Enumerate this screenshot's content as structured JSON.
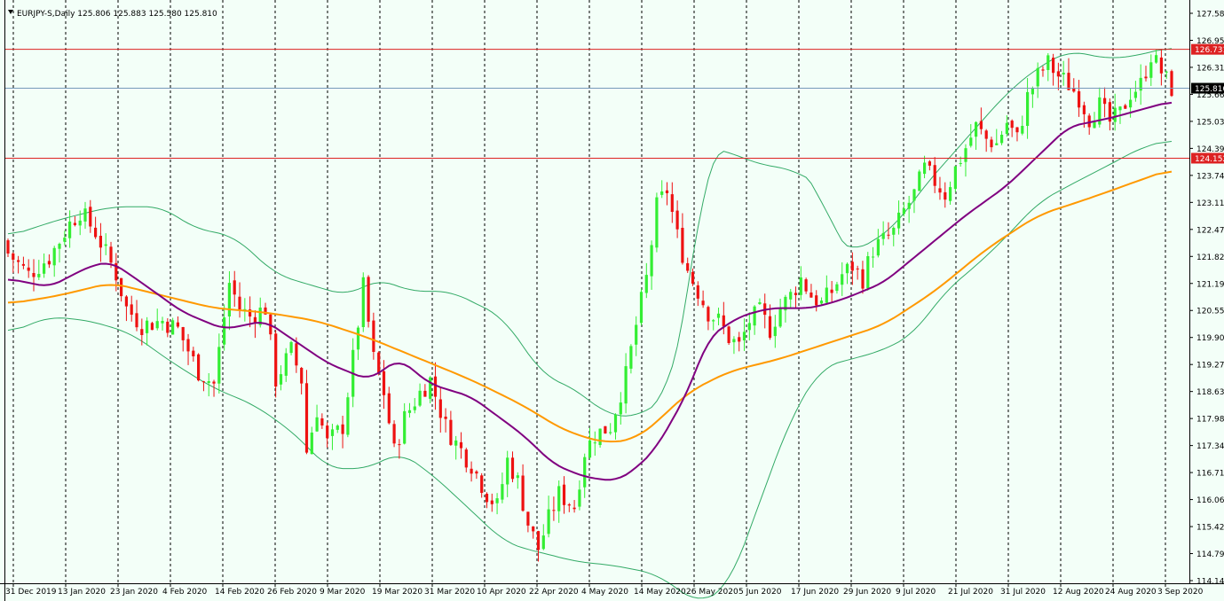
{
  "window": {
    "symbol_info": "EURJPY-S,Daily  125.806 125.883 125.580 125.810",
    "menu_icon": "triangle-down-icon"
  },
  "colors": {
    "background": "#f3fff8",
    "bull_candle": "#33ee33",
    "bear_candle": "#ee1111",
    "bollinger": "#33aa66",
    "ma_fast": "#800080",
    "ma_slow": "#ff9900",
    "hline": "#dd2222",
    "price_line": "#7799bb",
    "grid": "#000000"
  },
  "price_axis": {
    "ticks": [
      "127.585",
      "126.955",
      "126.310",
      "125.665",
      "125.035",
      "124.390",
      "123.745",
      "123.115",
      "122.470",
      "121.825",
      "121.195",
      "120.550",
      "119.905",
      "119.275",
      "118.630",
      "117.985",
      "117.340",
      "116.710",
      "116.065",
      "115.420",
      "114.790",
      "114.145"
    ],
    "hline_labels": [
      "126.731",
      "124.152"
    ],
    "current_price_label": "125.810"
  },
  "time_axis": {
    "labels": [
      "31 Dec 2019",
      "13 Jan 2020",
      "23 Jan 2020",
      "4 Feb 2020",
      "14 Feb 2020",
      "26 Feb 2020",
      "9 Mar 2020",
      "19 Mar 2020",
      "31 Mar 2020",
      "10 Apr 2020",
      "22 Apr 2020",
      "4 May 2020",
      "14 May 2020",
      "26 May 2020",
      "5 Jun 2020",
      "17 Jun 2020",
      "29 Jun 2020",
      "9 Jul 2020",
      "21 Jul 2020",
      "31 Jul 2020",
      "12 Aug 2020",
      "24 Aug 2020",
      "3 Sep 2020"
    ]
  },
  "chart_data": {
    "type": "candlestick",
    "title": "EURJPY-S,Daily",
    "ohlc_latest": {
      "open": 125.806,
      "high": 125.883,
      "low": 125.58,
      "close": 125.81
    },
    "ylim": [
      114.145,
      127.585
    ],
    "horizontal_lines": [
      126.731,
      124.152
    ],
    "current_price": 125.81,
    "close_path_anchors": [
      [
        0,
        121.9
      ],
      [
        4,
        121.4
      ],
      [
        8,
        121.8
      ],
      [
        12,
        122.6
      ],
      [
        14,
        122.9
      ],
      [
        17,
        122.4
      ],
      [
        21,
        121.4
      ],
      [
        23,
        120.6
      ],
      [
        26,
        120.2
      ],
      [
        30,
        120.3
      ],
      [
        33,
        120.1
      ],
      [
        35,
        119.6
      ],
      [
        37,
        119.1
      ],
      [
        40,
        118.8
      ],
      [
        43,
        121.2
      ],
      [
        45,
        120.6
      ],
      [
        47,
        120.4
      ],
      [
        50,
        120.6
      ],
      [
        52,
        118.9
      ],
      [
        55,
        119.6
      ],
      [
        57,
        118.9
      ],
      [
        58,
        117.2
      ],
      [
        60,
        118.2
      ],
      [
        62,
        117.4
      ],
      [
        65,
        117.8
      ],
      [
        67,
        119.4
      ],
      [
        69,
        121.1
      ],
      [
        71,
        119.4
      ],
      [
        73,
        118.6
      ],
      [
        75,
        117.2
      ],
      [
        77,
        118.0
      ],
      [
        80,
        118.6
      ],
      [
        82,
        118.9
      ],
      [
        85,
        117.8
      ],
      [
        87,
        117.4
      ],
      [
        90,
        116.9
      ],
      [
        93,
        116.2
      ],
      [
        95,
        115.9
      ],
      [
        97,
        117.0
      ],
      [
        99,
        116.5
      ],
      [
        101,
        115.5
      ],
      [
        103,
        114.9
      ],
      [
        105,
        115.6
      ],
      [
        107,
        116.2
      ],
      [
        110,
        115.9
      ],
      [
        112,
        117.2
      ],
      [
        114,
        117.6
      ],
      [
        117,
        117.8
      ],
      [
        120,
        119.0
      ],
      [
        122,
        120.2
      ],
      [
        124,
        121.3
      ],
      [
        126,
        123.0
      ],
      [
        128,
        123.4
      ],
      [
        130,
        122.3
      ],
      [
        132,
        121.5
      ],
      [
        134,
        121.0
      ],
      [
        136,
        120.5
      ],
      [
        138,
        120.3
      ],
      [
        140,
        119.9
      ],
      [
        142,
        119.7
      ],
      [
        144,
        120.3
      ],
      [
        146,
        120.5
      ],
      [
        148,
        120.1
      ],
      [
        150,
        120.6
      ],
      [
        152,
        120.9
      ],
      [
        154,
        121.3
      ],
      [
        156,
        120.9
      ],
      [
        158,
        120.7
      ],
      [
        160,
        121.0
      ],
      [
        162,
        121.4
      ],
      [
        164,
        121.6
      ],
      [
        166,
        121.3
      ],
      [
        168,
        122.0
      ],
      [
        170,
        122.2
      ],
      [
        172,
        122.4
      ],
      [
        174,
        122.9
      ],
      [
        176,
        123.3
      ],
      [
        178,
        123.9
      ],
      [
        180,
        123.6
      ],
      [
        182,
        123.3
      ],
      [
        184,
        123.9
      ],
      [
        186,
        124.4
      ],
      [
        188,
        124.9
      ],
      [
        190,
        124.6
      ],
      [
        192,
        124.5
      ],
      [
        194,
        125.0
      ],
      [
        196,
        124.6
      ],
      [
        198,
        125.6
      ],
      [
        200,
        126.1
      ],
      [
        202,
        126.4
      ],
      [
        204,
        126.1
      ],
      [
        206,
        125.9
      ],
      [
        208,
        125.6
      ],
      [
        210,
        125.1
      ],
      [
        212,
        125.4
      ],
      [
        214,
        125.0
      ],
      [
        216,
        125.2
      ],
      [
        218,
        125.7
      ],
      [
        220,
        125.9
      ],
      [
        222,
        126.6
      ],
      [
        224,
        126.2
      ],
      [
        226,
        125.8
      ]
    ],
    "ma_slow_anchors": [
      [
        0,
        120.7
      ],
      [
        10,
        120.9
      ],
      [
        20,
        121.2
      ],
      [
        30,
        120.9
      ],
      [
        40,
        120.6
      ],
      [
        50,
        120.5
      ],
      [
        60,
        120.3
      ],
      [
        70,
        119.9
      ],
      [
        80,
        119.4
      ],
      [
        90,
        118.9
      ],
      [
        100,
        118.3
      ],
      [
        108,
        117.7
      ],
      [
        116,
        117.4
      ],
      [
        122,
        117.5
      ],
      [
        126,
        117.9
      ],
      [
        132,
        118.6
      ],
      [
        140,
        119.1
      ],
      [
        150,
        119.4
      ],
      [
        160,
        119.8
      ],
      [
        170,
        120.2
      ],
      [
        180,
        121.0
      ],
      [
        190,
        122.0
      ],
      [
        200,
        122.8
      ],
      [
        210,
        123.2
      ],
      [
        226,
        123.9
      ]
    ],
    "ma_fast_anchors": [
      [
        0,
        121.3
      ],
      [
        8,
        121.1
      ],
      [
        16,
        121.6
      ],
      [
        20,
        121.7
      ],
      [
        26,
        121.2
      ],
      [
        34,
        120.5
      ],
      [
        42,
        120.1
      ],
      [
        50,
        120.3
      ],
      [
        56,
        119.8
      ],
      [
        62,
        119.3
      ],
      [
        70,
        118.9
      ],
      [
        76,
        119.4
      ],
      [
        82,
        118.8
      ],
      [
        90,
        118.5
      ],
      [
        100,
        117.6
      ],
      [
        106,
        116.9
      ],
      [
        112,
        116.6
      ],
      [
        118,
        116.5
      ],
      [
        122,
        116.8
      ],
      [
        126,
        117.3
      ],
      [
        132,
        118.6
      ],
      [
        136,
        119.9
      ],
      [
        142,
        120.4
      ],
      [
        148,
        120.6
      ],
      [
        156,
        120.6
      ],
      [
        162,
        120.8
      ],
      [
        170,
        121.2
      ],
      [
        178,
        122.0
      ],
      [
        186,
        122.8
      ],
      [
        194,
        123.5
      ],
      [
        200,
        124.2
      ],
      [
        206,
        124.9
      ],
      [
        214,
        125.1
      ],
      [
        220,
        125.3
      ],
      [
        226,
        125.5
      ]
    ],
    "bb_upper_anchors": [
      [
        0,
        122.3
      ],
      [
        10,
        122.7
      ],
      [
        20,
        123.0
      ],
      [
        30,
        123.0
      ],
      [
        36,
        122.5
      ],
      [
        44,
        122.3
      ],
      [
        52,
        121.4
      ],
      [
        60,
        121.1
      ],
      [
        66,
        120.9
      ],
      [
        72,
        121.3
      ],
      [
        78,
        121.0
      ],
      [
        86,
        121.0
      ],
      [
        96,
        120.4
      ],
      [
        104,
        119.0
      ],
      [
        110,
        118.7
      ],
      [
        116,
        118.1
      ],
      [
        122,
        118.0
      ],
      [
        128,
        118.5
      ],
      [
        132,
        120.6
      ],
      [
        134,
        122.8
      ],
      [
        136,
        124.4
      ],
      [
        140,
        124.3
      ],
      [
        146,
        124.0
      ],
      [
        152,
        123.9
      ],
      [
        158,
        123.5
      ],
      [
        160,
        122.3
      ],
      [
        164,
        121.9
      ],
      [
        172,
        122.5
      ],
      [
        178,
        123.5
      ],
      [
        186,
        124.6
      ],
      [
        194,
        125.7
      ],
      [
        200,
        126.3
      ],
      [
        206,
        126.7
      ],
      [
        214,
        126.5
      ],
      [
        220,
        126.6
      ],
      [
        226,
        126.8
      ]
    ],
    "bb_lower_anchors": [
      [
        0,
        120.0
      ],
      [
        8,
        120.4
      ],
      [
        16,
        120.3
      ],
      [
        24,
        120.0
      ],
      [
        32,
        119.3
      ],
      [
        40,
        118.7
      ],
      [
        48,
        118.3
      ],
      [
        56,
        117.6
      ],
      [
        62,
        116.8
      ],
      [
        70,
        116.8
      ],
      [
        76,
        117.2
      ],
      [
        82,
        116.7
      ],
      [
        90,
        115.8
      ],
      [
        96,
        115.1
      ],
      [
        100,
        114.9
      ],
      [
        104,
        114.8
      ],
      [
        110,
        114.6
      ],
      [
        118,
        114.5
      ],
      [
        126,
        114.3
      ],
      [
        134,
        113.6
      ],
      [
        140,
        114.0
      ],
      [
        146,
        116.0
      ],
      [
        152,
        118.0
      ],
      [
        158,
        119.2
      ],
      [
        164,
        119.4
      ],
      [
        170,
        119.6
      ],
      [
        176,
        120.0
      ],
      [
        182,
        121.0
      ],
      [
        188,
        121.6
      ],
      [
        194,
        122.3
      ],
      [
        200,
        123.1
      ],
      [
        206,
        123.5
      ],
      [
        214,
        124.0
      ],
      [
        220,
        124.4
      ],
      [
        226,
        124.6
      ]
    ]
  }
}
